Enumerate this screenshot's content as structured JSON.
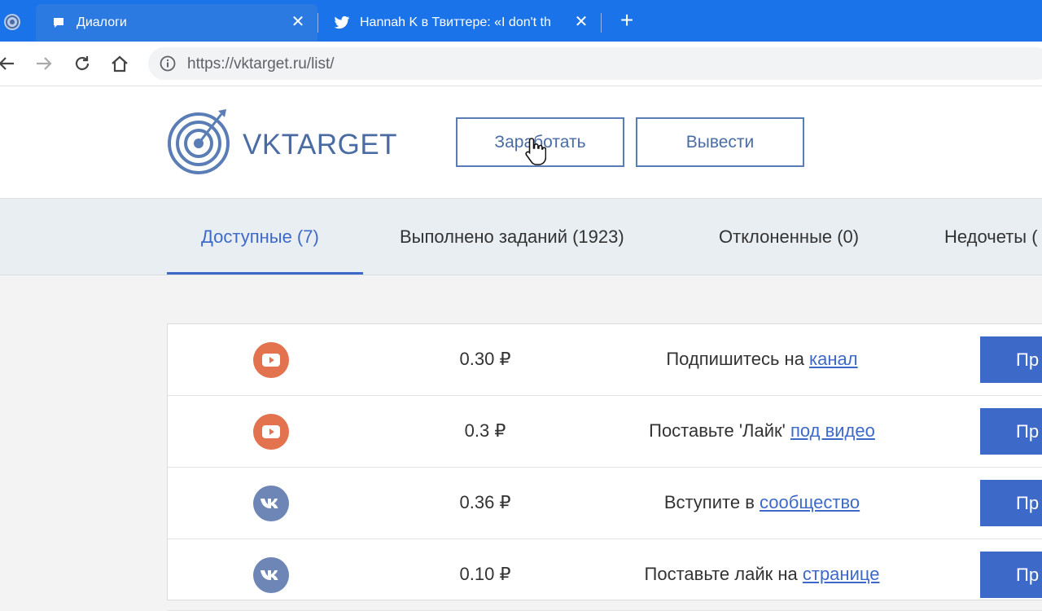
{
  "browser": {
    "tabs": [
      {
        "title": "Диалоги",
        "active": true
      },
      {
        "title": "Hannah K в Твиттере: «I don't th",
        "active": false
      }
    ],
    "new_tab": "+",
    "close_glyph": "✕",
    "url": "https://vktarget.ru/list/"
  },
  "site": {
    "logo_text": "VKTARGET",
    "earn_button": "Заработать",
    "withdraw_button": "Вывести"
  },
  "filters": [
    {
      "label": "Доступные (7)",
      "active": true
    },
    {
      "label": "Выполнено заданий (1923)",
      "active": false
    },
    {
      "label": "Отклоненные (0)",
      "active": false
    },
    {
      "label": "Недочеты (",
      "active": false
    }
  ],
  "tasks": [
    {
      "icon": "youtube-icon",
      "price": "0.30 ₽",
      "text": "Подпишитесь на ",
      "link": "канал",
      "action": "Пр"
    },
    {
      "icon": "youtube-icon",
      "price": "0.3 ₽",
      "text": "Поставьте 'Лайк' ",
      "link": "под видео",
      "action": "Пр"
    },
    {
      "icon": "vk-icon",
      "price": "0.36 ₽",
      "text": "Вступите в ",
      "link": "сообщество",
      "action": "Пр"
    },
    {
      "icon": "vk-icon",
      "price": "0.10 ₽",
      "text": "Поставьте лайк на ",
      "link": "странице",
      "action": "Пр"
    }
  ],
  "colors": {
    "tabstrip": "#1a73e8",
    "brand": "#4a6ca3",
    "link": "#3d6ac9",
    "youtube": "#e2734e",
    "vk": "#6d86b5"
  }
}
